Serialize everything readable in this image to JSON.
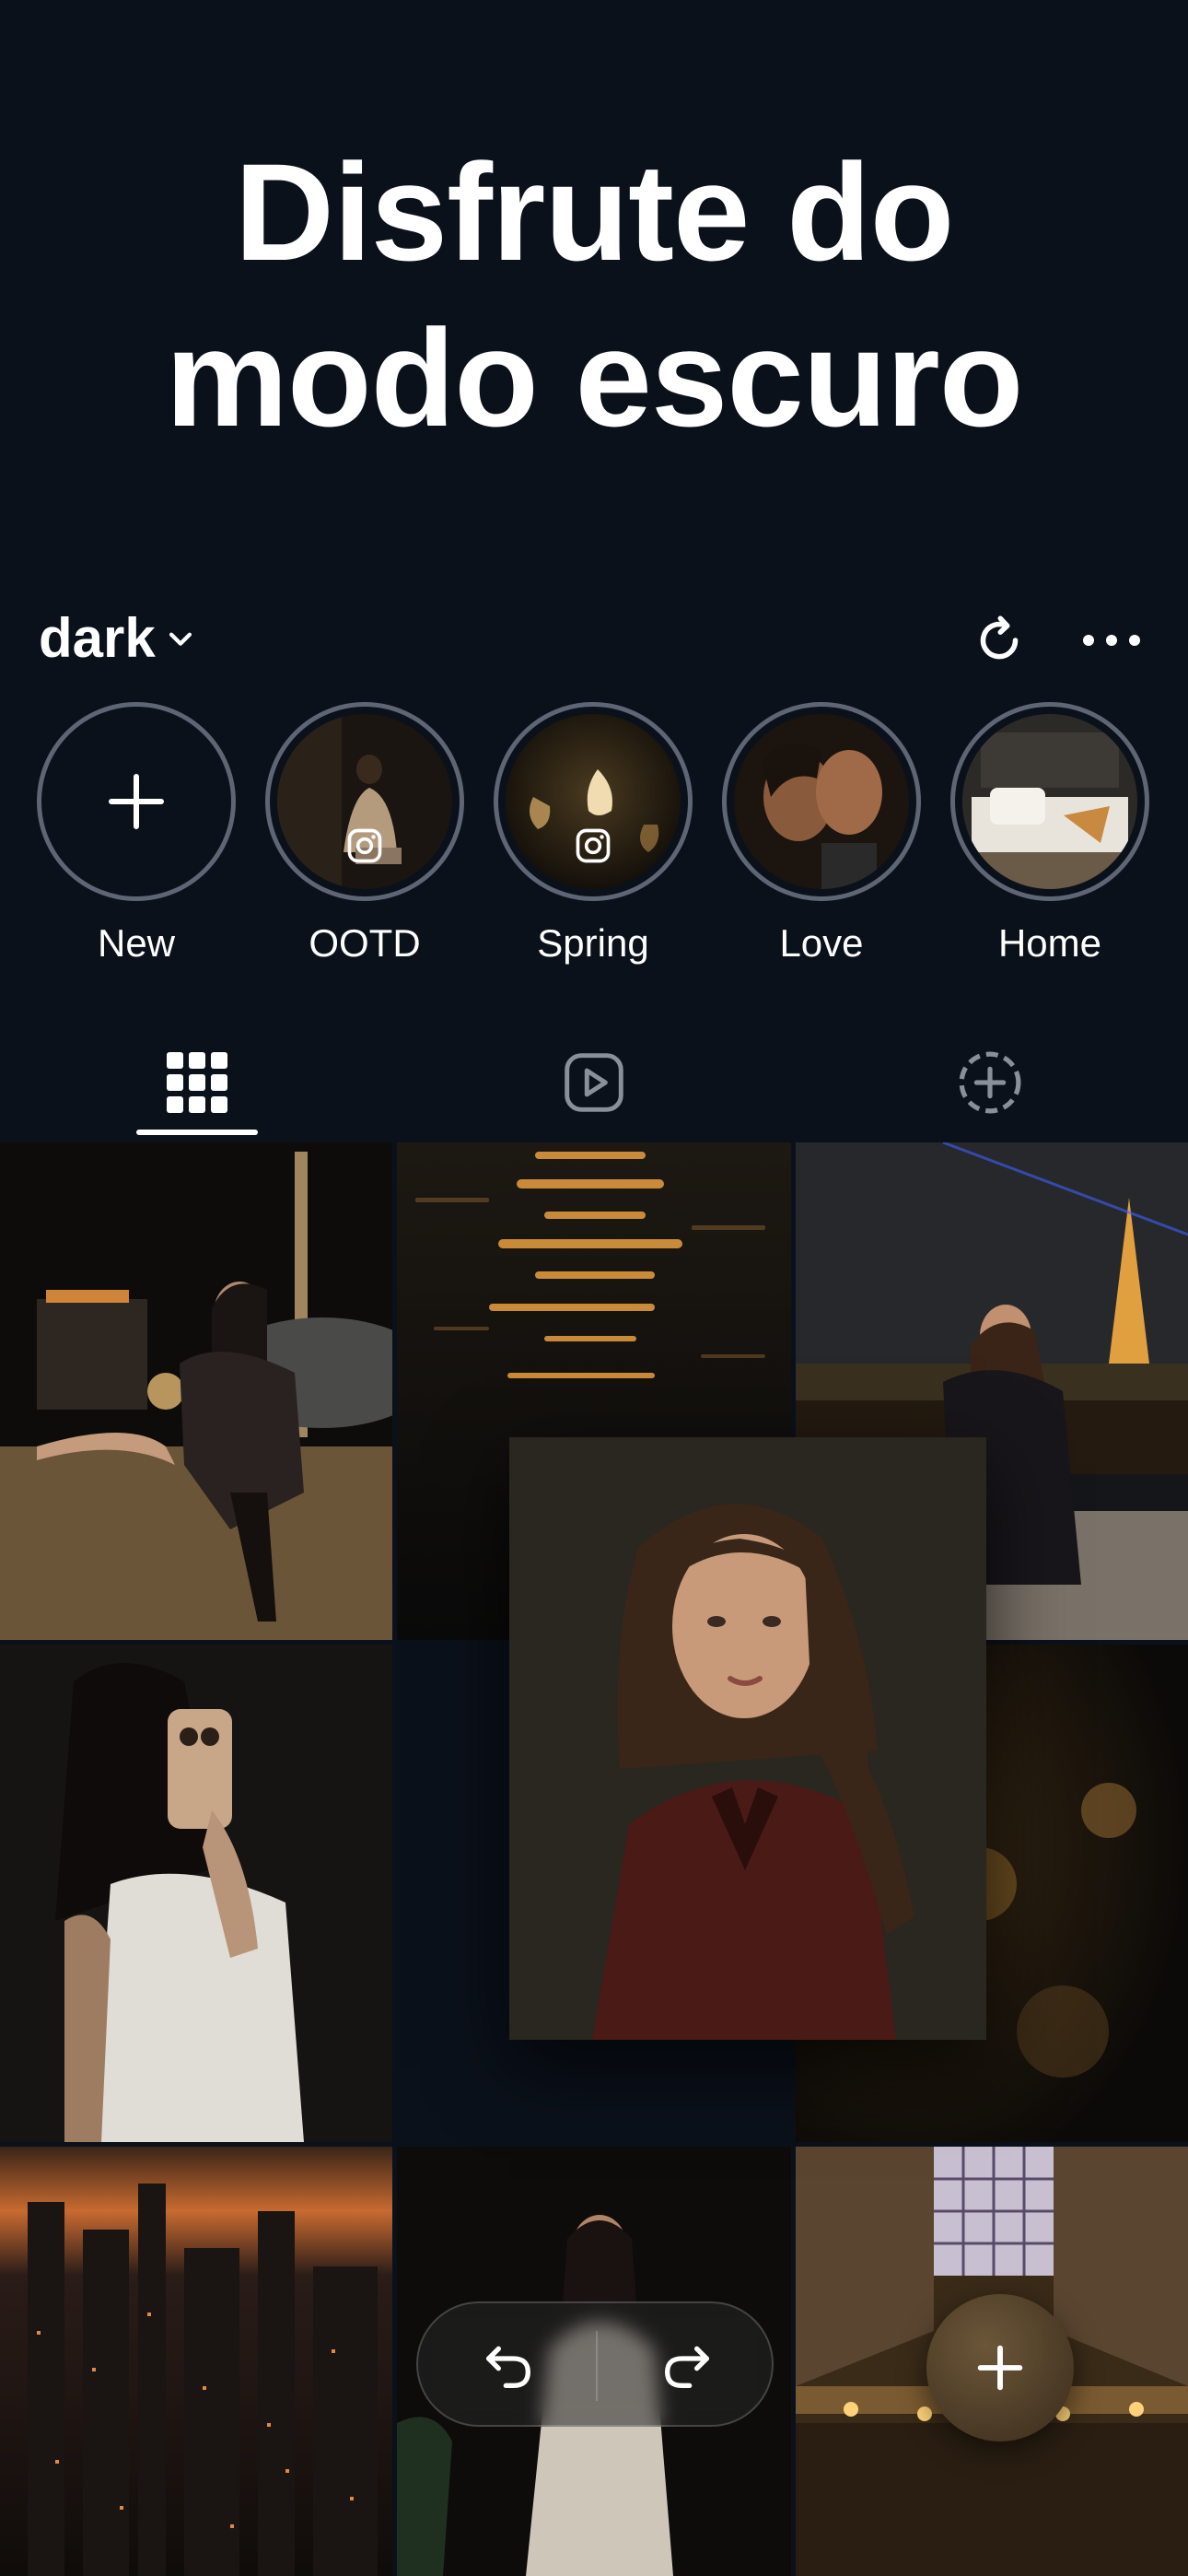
{
  "headline": {
    "line1": "Disfrute do",
    "line2": "modo escuro"
  },
  "profile": {
    "name": "dark"
  },
  "highlights": [
    {
      "label": "New"
    },
    {
      "label": "OOTD"
    },
    {
      "label": "Spring"
    },
    {
      "label": "Love"
    },
    {
      "label": "Home"
    }
  ],
  "icons": {
    "chevron": "chevron-down-icon",
    "refresh": "refresh-icon",
    "more": "more-icon",
    "tabs": [
      "grid-icon",
      "reels-icon",
      "add-circle-icon"
    ],
    "undo": "undo-icon",
    "redo": "redo-icon",
    "fab": "plus-icon"
  },
  "colors": {
    "background": "#0b111b",
    "ring": "#5e6675",
    "text": "#ffffff"
  }
}
